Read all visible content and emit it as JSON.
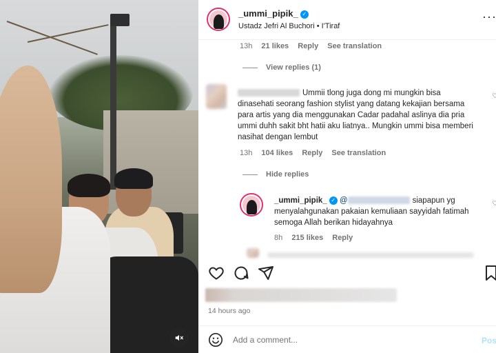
{
  "post": {
    "username": "_ummi_pipik_",
    "subtitle": "Ustadz Jefri Al Buchori • I'Tiraf",
    "more_icon": "more-dots-icon"
  },
  "comments": {
    "prev_meta": {
      "time": "13h",
      "likes": "21 likes",
      "reply": "Reply",
      "translate": "See translation"
    },
    "view_replies": "View replies (1)",
    "main": {
      "text": "Ummii tlong juga dong mi mungkin bisa dinasehati seorang fashion stylist yang datang kekajian bersama para artis yang dia menggunakan Cadar padahal aslinya dia pria ummi duhh sakit bht hatii aku liatnya.. Mungkin ummi bisa memberi nasihat dengan lembut",
      "time": "13h",
      "likes": "104 likes",
      "reply": "Reply",
      "translate": "See translation"
    },
    "hide_replies": "Hide replies",
    "reply": {
      "username": "_ummi_pipik_",
      "mention": "@",
      "text_first": "siapapun yg",
      "text_rest": "menyalahgunakan pakaian kemuliaan sayyidah fatimah semoga Allah berikan hidayahnya",
      "time": "8h",
      "likes": "215 likes",
      "reply": "Reply"
    }
  },
  "footer": {
    "time_ago": "14 hours ago",
    "comment_placeholder": "Add a comment...",
    "post_label": "Post"
  },
  "colors": {
    "accent": "#0095f6",
    "ring": "#e1306c",
    "muted": "#737373",
    "text": "#262626"
  }
}
